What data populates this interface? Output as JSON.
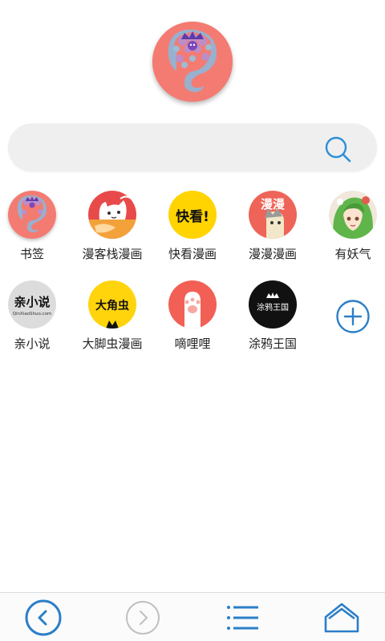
{
  "logo": {
    "icon": "app-logo-icon",
    "color": "#f47b72"
  },
  "search": {
    "placeholder": "",
    "value": "",
    "icon": "search-icon",
    "accent": "#2b8fd8"
  },
  "bookmarks": [
    {
      "label": "书签",
      "icon": "bookmark-logo-icon",
      "color": "#f47b72"
    },
    {
      "label": "漫客栈漫画",
      "icon": "cat-mascot-icon",
      "color": "#e84a4a"
    },
    {
      "label": "快看漫画",
      "icon": "kuaikan-logo-icon",
      "color": "#ffd400",
      "logo_text": "快看!"
    },
    {
      "label": "漫漫漫画",
      "icon": "manman-logo-icon",
      "color": "#ef6458",
      "logo_text": "漫漫"
    },
    {
      "label": "有妖气",
      "icon": "green-hair-girl-icon",
      "color": "#e35b4f"
    },
    {
      "label": "亲小说",
      "icon": "qinxiaoshuo-logo-icon",
      "color": "#dcdcdc",
      "logo_text": "亲小说",
      "logo_subtext": "QinXiaoShuo.com"
    },
    {
      "label": "大脚虫漫画",
      "icon": "dajiaochong-logo-icon",
      "color": "#ffd40d",
      "logo_text": "大角虫"
    },
    {
      "label": "嘀哩哩",
      "icon": "paw-icon",
      "color": "#f26055"
    },
    {
      "label": "涂鸦王国",
      "icon": "tuya-logo-icon",
      "color": "#111111",
      "logo_text": "涂鸦王国"
    }
  ],
  "add_button": {
    "icon": "plus-icon",
    "color": "#2b7fc8"
  },
  "bottom_nav": {
    "back": {
      "icon": "back-arrow-icon",
      "color": "#2b7fc8"
    },
    "forward": {
      "icon": "forward-arrow-icon",
      "color": "#bfbfbf"
    },
    "menu": {
      "icon": "list-menu-icon",
      "color": "#2b7fc8"
    },
    "home": {
      "icon": "home-icon",
      "color": "#2b7fc8"
    }
  }
}
